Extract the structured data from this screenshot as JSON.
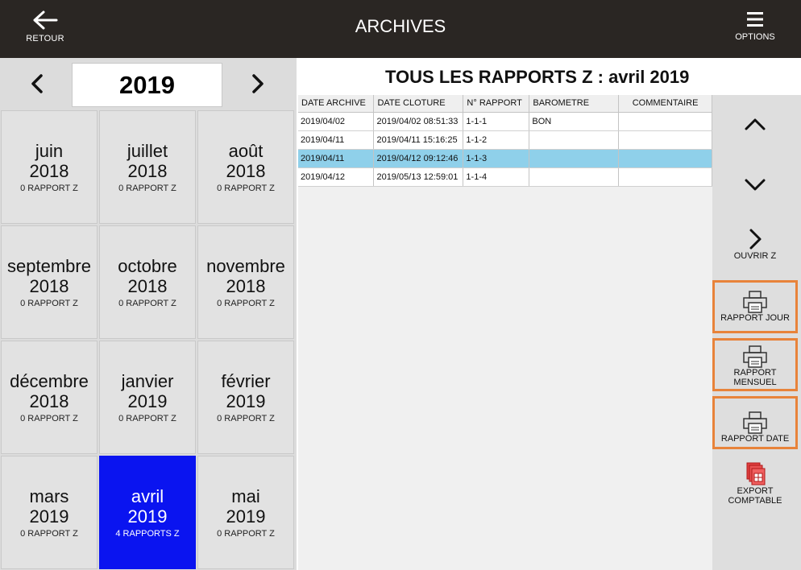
{
  "topbar": {
    "back_label": "RETOUR",
    "title": "ARCHIVES",
    "options_label": "OPTIONS"
  },
  "year_nav": {
    "year": "2019"
  },
  "months": [
    {
      "month": "juin",
      "year": "2018",
      "count": "0 RAPPORT Z"
    },
    {
      "month": "juillet",
      "year": "2018",
      "count": "0 RAPPORT Z"
    },
    {
      "month": "août",
      "year": "2018",
      "count": "0 RAPPORT Z"
    },
    {
      "month": "septembre",
      "year": "2018",
      "count": "0 RAPPORT Z"
    },
    {
      "month": "octobre",
      "year": "2018",
      "count": "0 RAPPORT Z"
    },
    {
      "month": "novembre",
      "year": "2018",
      "count": "0 RAPPORT Z"
    },
    {
      "month": "décembre",
      "year": "2018",
      "count": "0 RAPPORT Z"
    },
    {
      "month": "janvier",
      "year": "2019",
      "count": "0 RAPPORT Z"
    },
    {
      "month": "février",
      "year": "2019",
      "count": "0 RAPPORT Z"
    },
    {
      "month": "mars",
      "year": "2019",
      "count": "0 RAPPORT Z"
    },
    {
      "month": "avril",
      "year": "2019",
      "count": "4 RAPPORTS Z",
      "selected": true
    },
    {
      "month": "mai",
      "year": "2019",
      "count": "0 RAPPORT Z"
    }
  ],
  "report": {
    "title": "TOUS LES RAPPORTS Z :  avril 2019",
    "columns": [
      "DATE ARCHIVE",
      "DATE CLOTURE",
      "N° RAPPORT",
      "BAROMETRE",
      "COMMENTAIRE"
    ],
    "rows": [
      [
        "2019/04/02",
        "2019/04/02 08:51:33",
        "1-1-1",
        "BON",
        ""
      ],
      [
        "2019/04/11",
        "2019/04/11 15:16:25",
        "1-1-2",
        "",
        ""
      ],
      [
        "2019/04/11",
        "2019/04/12 09:12:46",
        "1-1-3",
        "",
        ""
      ],
      [
        "2019/04/12",
        "2019/05/13 12:59:01",
        "1-1-4",
        "",
        ""
      ]
    ],
    "selected_row": 2
  },
  "side": {
    "open_z": "OUVRIR Z",
    "rapport_jour": "RAPPORT JOUR",
    "rapport_mensuel_1": "RAPPORT",
    "rapport_mensuel_2": "MENSUEL",
    "rapport_date": "RAPPORT DATE",
    "export_1": "EXPORT",
    "export_2": "COMPTABLE"
  },
  "colors": {
    "topbar_bg": "#2a2623",
    "selected_month_bg": "#0a14f0",
    "selected_row_bg": "#8fd0ea",
    "highlight_border": "#e8833a"
  },
  "icons": {
    "back": "arrow-left-icon",
    "options": "hamburger-menu-icon",
    "prev_year": "chevron-left-icon",
    "next_year": "chevron-right-icon",
    "scroll_up": "chevron-up-icon",
    "scroll_down": "chevron-down-icon",
    "open_z": "chevron-right-icon",
    "print": "printer-icon",
    "export": "export-document-icon"
  }
}
